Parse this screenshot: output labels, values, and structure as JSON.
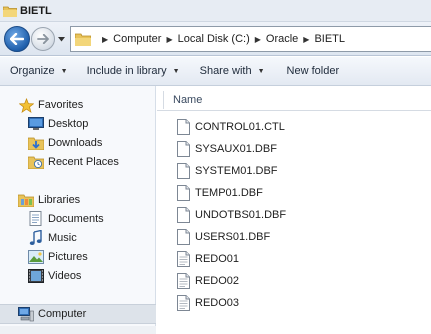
{
  "window": {
    "title": "BIETL"
  },
  "breadcrumb": [
    "Computer",
    "Local Disk (C:)",
    "Oracle",
    "BIETL"
  ],
  "toolbar": {
    "organize": "Organize",
    "include_in_library": "Include in library",
    "share_with": "Share with",
    "new_folder": "New folder"
  },
  "navpane": {
    "favorites": "Favorites",
    "desktop": "Desktop",
    "downloads": "Downloads",
    "recent_places": "Recent Places",
    "libraries": "Libraries",
    "documents": "Documents",
    "music": "Music",
    "pictures": "Pictures",
    "videos": "Videos",
    "computer": "Computer"
  },
  "content": {
    "column_name": "Name",
    "files": [
      "CONTROL01.CTL",
      "SYSAUX01.DBF",
      "SYSTEM01.DBF",
      "TEMP01.DBF",
      "UNDOTBS01.DBF",
      "USERS01.DBF",
      "REDO01",
      "REDO02",
      "REDO03"
    ]
  }
}
